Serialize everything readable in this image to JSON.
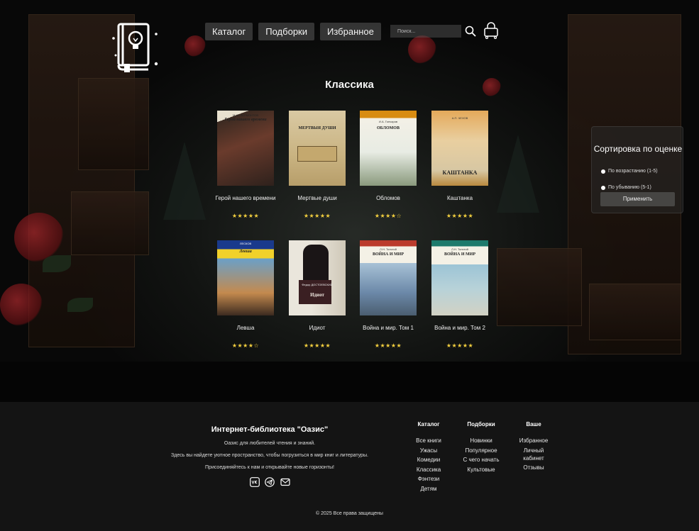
{
  "header": {
    "nav": [
      "Каталог",
      "Подборки",
      "Избранное"
    ],
    "search_placeholder": "Поиск...",
    "logo_icon": "book-lightbulb-icon",
    "search_icon": "search-icon",
    "cart_icon": "cart-icon"
  },
  "page": {
    "title": "Классика"
  },
  "books": [
    {
      "title": "Герой нашего времени",
      "stars": "★★★★★",
      "rating": 5,
      "cover_author": "М.Ю. ЛЕРМОНТОВ",
      "cover_title": "Герой нашего времени"
    },
    {
      "title": "Мертвые души",
      "stars": "★★★★★",
      "rating": 5,
      "cover_author": "",
      "cover_title": "МЕРТВЫЯ ДУШИ"
    },
    {
      "title": "Обломов",
      "stars": "★★★★☆",
      "rating": 4,
      "cover_author": "И.А. Гончаров",
      "cover_title": "ОБЛОМОВ"
    },
    {
      "title": "Каштанка",
      "stars": "★★★★★",
      "rating": 5,
      "cover_author": "А.П. ЧЕХОВ",
      "cover_title": "КАШТАНКА"
    },
    {
      "title": "Левша",
      "stars": "★★★★☆",
      "rating": 4,
      "cover_author": "ЛЕСКОВ",
      "cover_title": "Левша"
    },
    {
      "title": "Идиот",
      "stars": "★★★★★",
      "rating": 5,
      "cover_author": "Федор ДОСТОЕВСКИЙ",
      "cover_title": "Идиот"
    },
    {
      "title": "Война и мир. Том 1",
      "stars": "★★★★★",
      "rating": 5,
      "cover_author": "Л.Н. Толстой",
      "cover_title": "ВОЙНА И МИР"
    },
    {
      "title": "Война и мир. Том 2",
      "stars": "★★★★★",
      "rating": 5,
      "cover_author": "Л.Н. Толстой",
      "cover_title": "ВОЙНА И МИР"
    }
  ],
  "sort": {
    "title": "Сортировка по оценке",
    "options": [
      "По возрастанию (1-5)",
      "По убыванию (5-1)"
    ],
    "apply": "Применить"
  },
  "footer": {
    "title": "Интернет-библиотека \"Оазис\"",
    "lines": [
      "Оазис для любителей чтения и знаний.",
      "Здесь вы найдете уютное пространство, чтобы погрузиться в мир книг и литературы.",
      "Присоединяйтесь к нам и открывайте новые горизонты!"
    ],
    "social_icons": [
      "vk-icon",
      "telegram-icon",
      "mail-icon"
    ],
    "columns": [
      {
        "head": "Каталог",
        "items": [
          "Все книги",
          "Ужасы",
          "Комедии",
          "Классика",
          "Фэнтези",
          "Детям"
        ]
      },
      {
        "head": "Подборки",
        "items": [
          "Новинки",
          "Популярное",
          "С чего начать",
          "Культовые"
        ]
      },
      {
        "head": "Ваше",
        "items": [
          "Избранное",
          "Личный кабинет",
          "Отзывы"
        ]
      }
    ],
    "copyright": "© 2025 Все права защищены"
  },
  "colors": {
    "star": "#f4d03f",
    "footer_bg": "#141414",
    "nav_bg": "#5a5a5a"
  }
}
